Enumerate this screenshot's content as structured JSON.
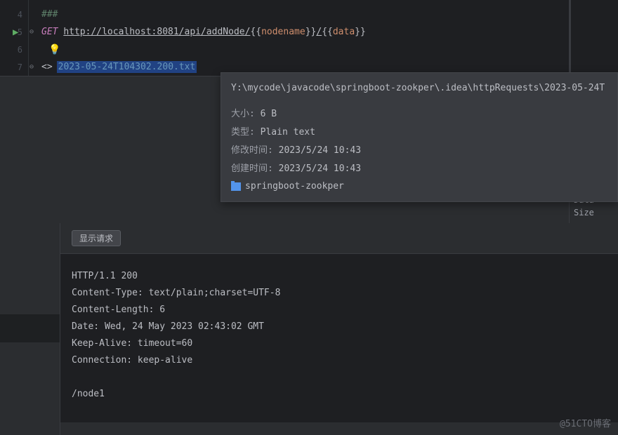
{
  "editor": {
    "lines": [
      "4",
      "5",
      "6",
      "7"
    ],
    "comment": "###",
    "method": "GET",
    "url_base": "http://localhost:8081/api/addNode/",
    "var1": "nodename",
    "var2": "data",
    "response_filename": "2023-05-24T104302.200.txt"
  },
  "tooltip": {
    "path": "Y:\\mycode\\javacode\\springboot-zookper\\.idea\\httpRequests\\2023-05-24T",
    "size_label": "大小:",
    "size_value": "6 B",
    "type_label": "类型:",
    "type_value": "Plain text",
    "modified_label": "修改时间:",
    "modified_value": "2023/5/24 10:43",
    "created_label": "创建时间:",
    "created_value": "2023/5/24 10:43",
    "project_name": "springboot-zookper"
  },
  "right_panel": {
    "data_label": "Data",
    "size_label": "Size"
  },
  "toolbar": {
    "show_request": "显示请求"
  },
  "response": {
    "status": "HTTP/1.1 200",
    "content_type": "Content-Type: text/plain;charset=UTF-8",
    "content_length": "Content-Length: 6",
    "date": "Date: Wed, 24 May 2023 02:43:02 GMT",
    "keep_alive": "Keep-Alive: timeout=60",
    "connection": "Connection: keep-alive",
    "body": "/node1"
  },
  "watermark": "@51CTO博客"
}
